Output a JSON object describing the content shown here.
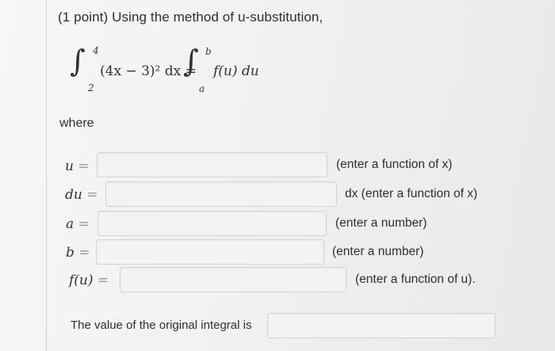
{
  "problem": {
    "title": "(1 point) Using the method of u-substitution,",
    "title_var": "u",
    "integral_left": {
      "lower": "2",
      "upper": "4",
      "integrand": "(4x − 3)² dx ="
    },
    "integral_right": {
      "lower": "a",
      "upper": "b",
      "integrand": "f(u) du"
    },
    "where": "where"
  },
  "fields": [
    {
      "label_var": "u",
      "hint": "(enter a function of x)",
      "value": ""
    },
    {
      "label_var": "du",
      "hint": "dx (enter a function of x)",
      "value": ""
    },
    {
      "label_var": "a",
      "hint": "(enter a number)",
      "value": ""
    },
    {
      "label_var": "b",
      "hint": "(enter a number)",
      "value": ""
    },
    {
      "label_var": "f(u)",
      "hint": "(enter a function of u).",
      "value": ""
    }
  ],
  "final": {
    "label": "The value of the original integral is",
    "value": ""
  }
}
